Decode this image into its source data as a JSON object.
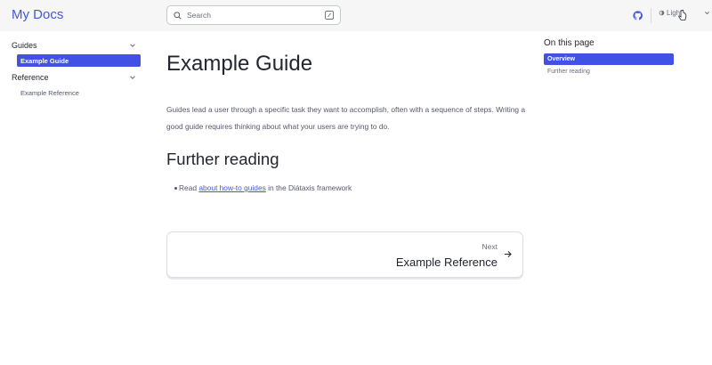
{
  "header": {
    "site_title": "My Docs",
    "search_placeholder": "Search",
    "theme_label": "Light",
    "icons": [
      "search-icon",
      "shortcut-icon",
      "github-icon",
      "theme-icon",
      "chevron-down-icon"
    ]
  },
  "sidebar": {
    "groups": [
      {
        "label": "Guides",
        "items": [
          {
            "label": "Example Guide",
            "active": true
          }
        ]
      },
      {
        "label": "Reference",
        "items": [
          {
            "label": "Example Reference",
            "active": false
          }
        ]
      }
    ]
  },
  "main": {
    "title": "Example Guide",
    "intro": "Guides lead a user through a specific task they want to accomplish, often with a sequence of steps. Writing a good guide requires thinking about what your users are trying to do.",
    "section_title": "Further reading",
    "bullet_prefix": "Read ",
    "bullet_link": "about how-to guides",
    "bullet_suffix": " in the Diátaxis framework",
    "next_label": "Next",
    "next_title": "Example Reference"
  },
  "toc": {
    "title": "On this page",
    "items": [
      {
        "label": "Overview",
        "active": true
      },
      {
        "label": "Further reading",
        "active": false
      }
    ]
  },
  "colors": {
    "accent": "#4151e6",
    "link": "#4457d6",
    "header_bg": "#f6f6f7"
  }
}
